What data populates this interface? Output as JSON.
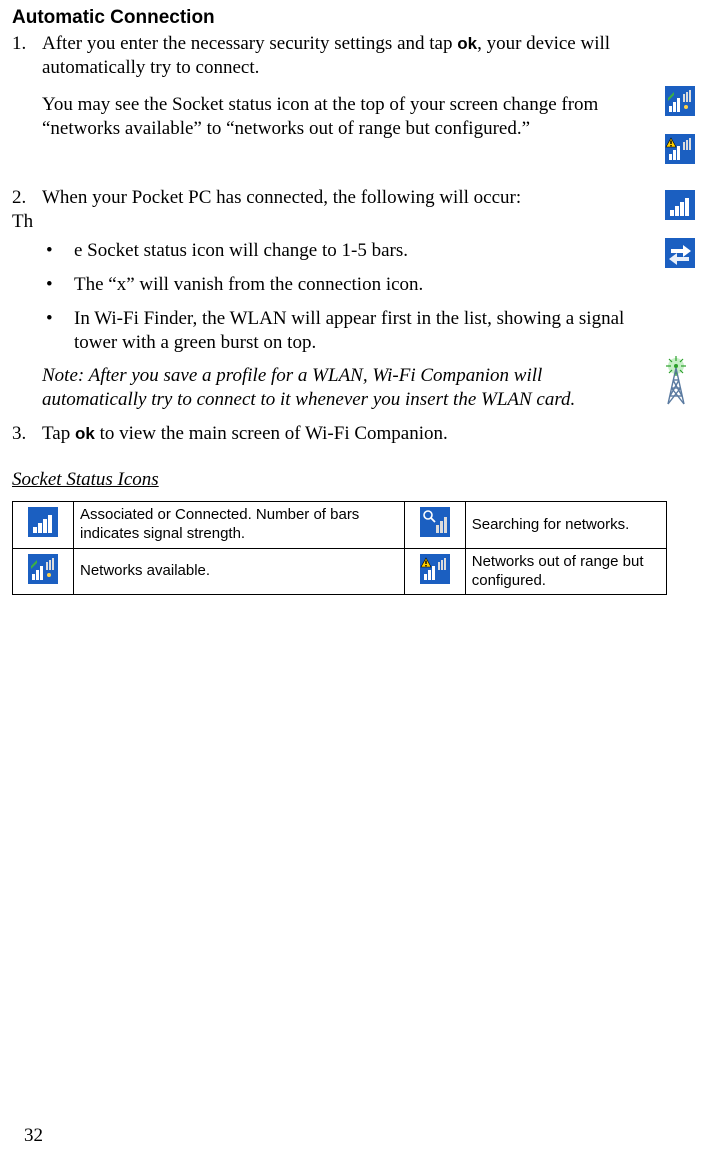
{
  "heading": "Automatic Connection",
  "step1_num": "1.",
  "step1_a_pre": "After you enter the necessary security settings and tap ",
  "step1_a_ok": "ok",
  "step1_a_post": ", your device will automatically try to connect.",
  "step1_b": "You may see the Socket status icon at the top of your screen change from “networks available” to “networks out of range but configured.”",
  "step2_num": "2.",
  "step2_line": "When your Pocket PC has connected, the following will occur:",
  "step2_th": "Th",
  "bullets": [
    "e Socket status icon will change to 1-5 bars.",
    "The “x” will vanish from the connection icon.",
    "In Wi-Fi Finder, the WLAN will appear first in the list, showing a signal tower with a green burst on top."
  ],
  "note": "Note: After you save a profile for a WLAN, Wi-Fi Companion will automatically try to connect to it whenever you insert the WLAN card.",
  "step3_num": "3.",
  "step3_pre": "Tap ",
  "step3_ok": "ok",
  "step3_post": " to view the main screen of Wi-Fi Companion.",
  "subheading": "Socket Status Icons",
  "table": {
    "r1c1": "Associated or Connected. Number of bars indicates signal strength.",
    "r1c2": "Searching for networks.",
    "r2c1": "Networks available.",
    "r2c2": "Networks out of range but configured."
  },
  "page_number": "32",
  "icons": {
    "networks_available": "networks-available-icon",
    "out_of_range": "networks-out-of-range-icon",
    "signal_bars": "signal-bars-icon",
    "connection_arrows": "connection-arrows-icon",
    "signal_tower": "signal-tower-green-burst-icon",
    "searching": "searching-networks-icon"
  }
}
